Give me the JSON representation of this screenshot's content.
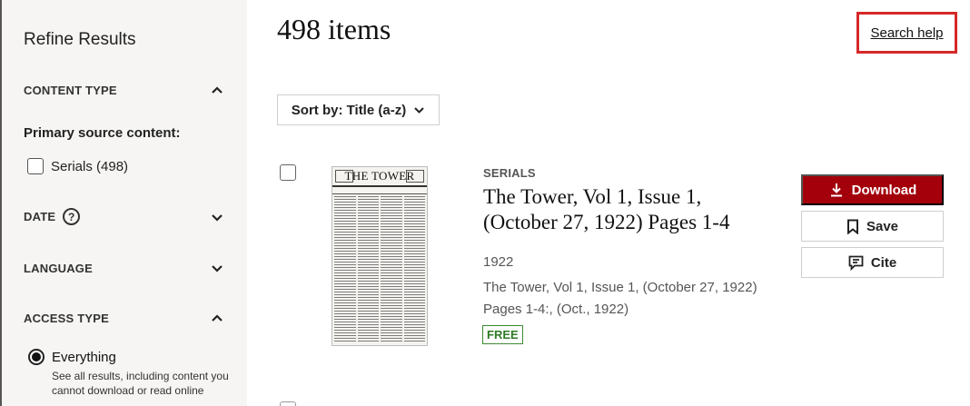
{
  "sidebar": {
    "title": "Refine Results",
    "facets": {
      "content_type": "CONTENT TYPE",
      "date": "DATE",
      "language": "LANGUAGE",
      "access_type": "ACCESS TYPE"
    },
    "primary_source_heading": "Primary source content:",
    "serials_option": "Serials (498)",
    "access_option": "Everything",
    "access_desc": "See all results, including content you cannot download or read online"
  },
  "results": {
    "count": "498 items",
    "search_help": "Search help",
    "sort_label": "Sort by: Title (a-z)"
  },
  "item": {
    "type": "SERIALS",
    "title": "The Tower, Vol 1, Issue 1, (October 27, 1922) Pages 1-4",
    "year": "1922",
    "source": "The Tower, Vol 1, Issue 1, (October 27, 1922)",
    "pages": "Pages 1-4:, (Oct., 1922)",
    "badge": "FREE",
    "thumb_title": "THE TOWER",
    "download": "Download",
    "save": "Save",
    "cite": "Cite"
  },
  "colors": {
    "accent": "#a3000b",
    "free": "#2f7a27",
    "highlight": "#d62828",
    "sidebar_bg": "#f6f5f3"
  },
  "icons": {
    "chevron_up": "chevron-up-icon",
    "chevron_down": "chevron-down-icon",
    "help": "help-circle-icon",
    "download": "download-icon",
    "save": "bookmark-icon",
    "cite": "cite-icon"
  }
}
